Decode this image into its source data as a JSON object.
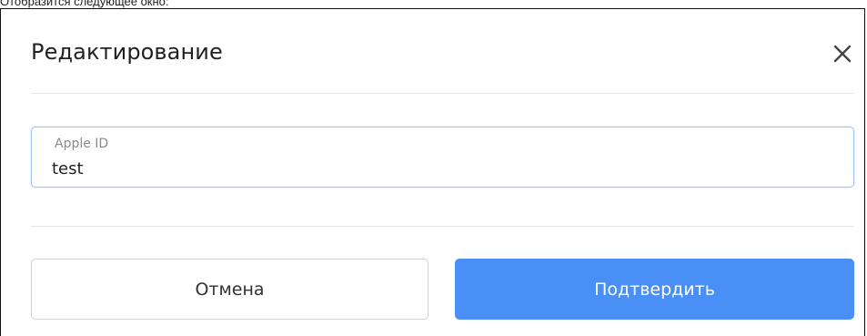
{
  "caption": "Отобразится следующее окно:",
  "dialog": {
    "title": "Редактирование",
    "close_icon": "close-icon",
    "field": {
      "label": "Apple ID",
      "value": "test"
    },
    "buttons": {
      "cancel_label": "Отмена",
      "confirm_label": "Подтвердить"
    }
  },
  "colors": {
    "accent": "#4a8ff5",
    "focus_border": "#9ec3f3"
  }
}
